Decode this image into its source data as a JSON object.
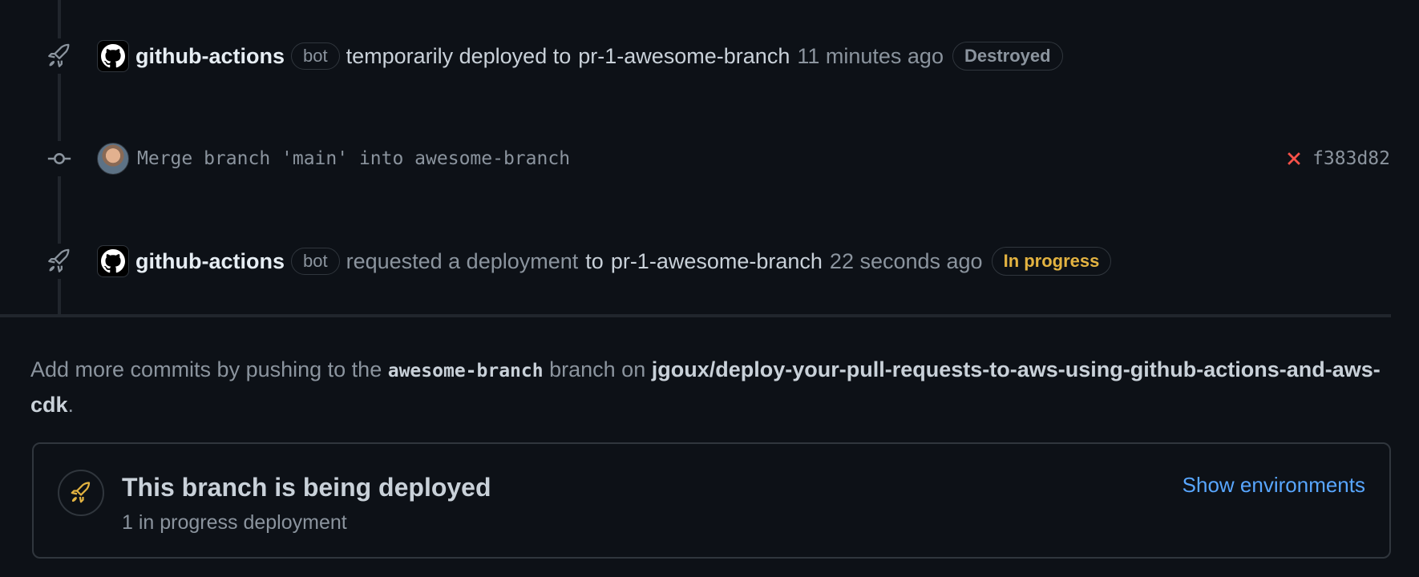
{
  "timeline": {
    "events": [
      {
        "actor": "github-actions",
        "badge": "bot",
        "action": "temporarily deployed to",
        "environment": "pr-1-awesome-branch",
        "time": "11 minutes ago",
        "status": "Destroyed",
        "status_color": "#8b949e"
      },
      {
        "message": "Merge branch 'main' into awesome-branch",
        "ci_status": "failure",
        "ci_color": "#f85149",
        "sha": "f383d82"
      },
      {
        "actor": "github-actions",
        "badge": "bot",
        "action": "requested a deployment",
        "to": "to",
        "environment": "pr-1-awesome-branch",
        "time": "22 seconds ago",
        "status": "In progress",
        "status_color": "#e3b341"
      }
    ]
  },
  "info": {
    "prefix": "Add more commits by pushing to the",
    "branch": "awesome-branch",
    "middle": "branch on",
    "repo": "jgoux/deploy-your-pull-requests-to-aws-using-github-actions-and-aws-cdk",
    "suffix": "."
  },
  "deployment": {
    "title": "This branch is being deployed",
    "subtitle": "1 in progress deployment",
    "link_label": "Show environments",
    "accent": "#e3b341"
  }
}
